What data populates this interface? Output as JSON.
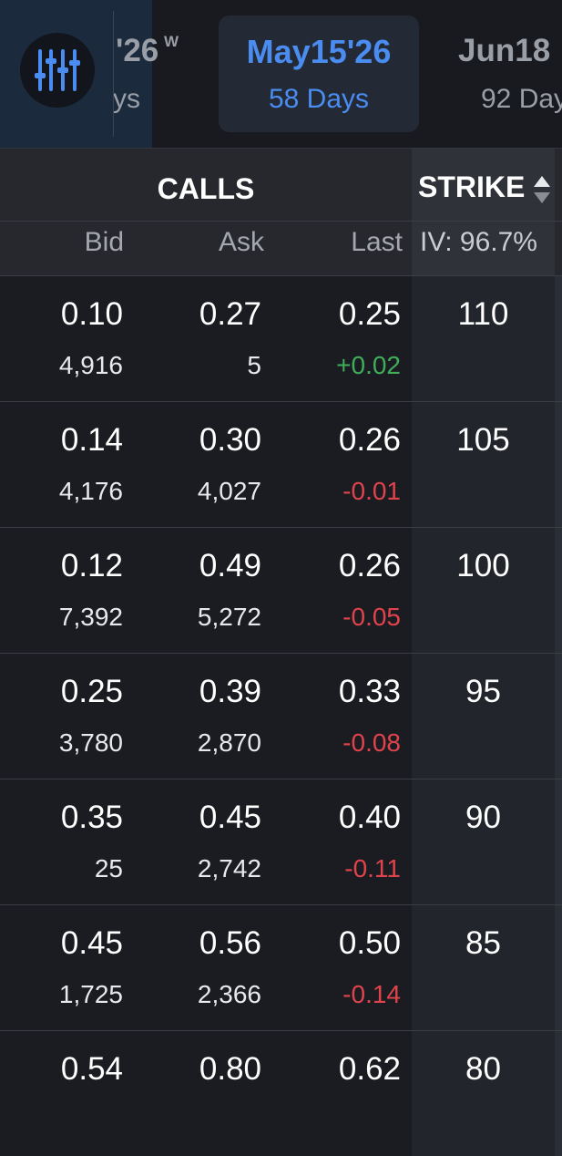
{
  "expiry_tabs": [
    {
      "date": "'26",
      "superscript": "W",
      "days": "ys"
    },
    {
      "date": "May15'26",
      "days": "58 Days",
      "selected": true
    },
    {
      "date": "Jun18",
      "days": "92 Day"
    }
  ],
  "filter_icon": "sliders-icon",
  "headers": {
    "calls": "CALLS",
    "strike": "STRIKE",
    "bid": "Bid",
    "ask": "Ask",
    "last": "Last",
    "iv": "IV: 96.7%"
  },
  "rows": [
    {
      "bid": "0.10",
      "bid_size": "4,916",
      "ask": "0.27",
      "ask_size": "5",
      "last": "0.25",
      "change": "+0.02",
      "direction": "up",
      "strike": "110"
    },
    {
      "bid": "0.14",
      "bid_size": "4,176",
      "ask": "0.30",
      "ask_size": "4,027",
      "last": "0.26",
      "change": "-0.01",
      "direction": "down",
      "strike": "105"
    },
    {
      "bid": "0.12",
      "bid_size": "7,392",
      "ask": "0.49",
      "ask_size": "5,272",
      "last": "0.26",
      "change": "-0.05",
      "direction": "down",
      "strike": "100"
    },
    {
      "bid": "0.25",
      "bid_size": "3,780",
      "ask": "0.39",
      "ask_size": "2,870",
      "last": "0.33",
      "change": "-0.08",
      "direction": "down",
      "strike": "95"
    },
    {
      "bid": "0.35",
      "bid_size": "25",
      "ask": "0.45",
      "ask_size": "2,742",
      "last": "0.40",
      "change": "-0.11",
      "direction": "down",
      "strike": "90"
    },
    {
      "bid": "0.45",
      "bid_size": "1,725",
      "ask": "0.56",
      "ask_size": "2,366",
      "last": "0.50",
      "change": "-0.14",
      "direction": "down",
      "strike": "85"
    },
    {
      "bid": "0.54",
      "bid_size": "",
      "ask": "0.80",
      "ask_size": "",
      "last": "0.62",
      "change": "",
      "direction": "",
      "strike": "80"
    }
  ],
  "colors": {
    "accent": "#4a8cf0",
    "up": "#3fae5a",
    "down": "#e0434c"
  }
}
